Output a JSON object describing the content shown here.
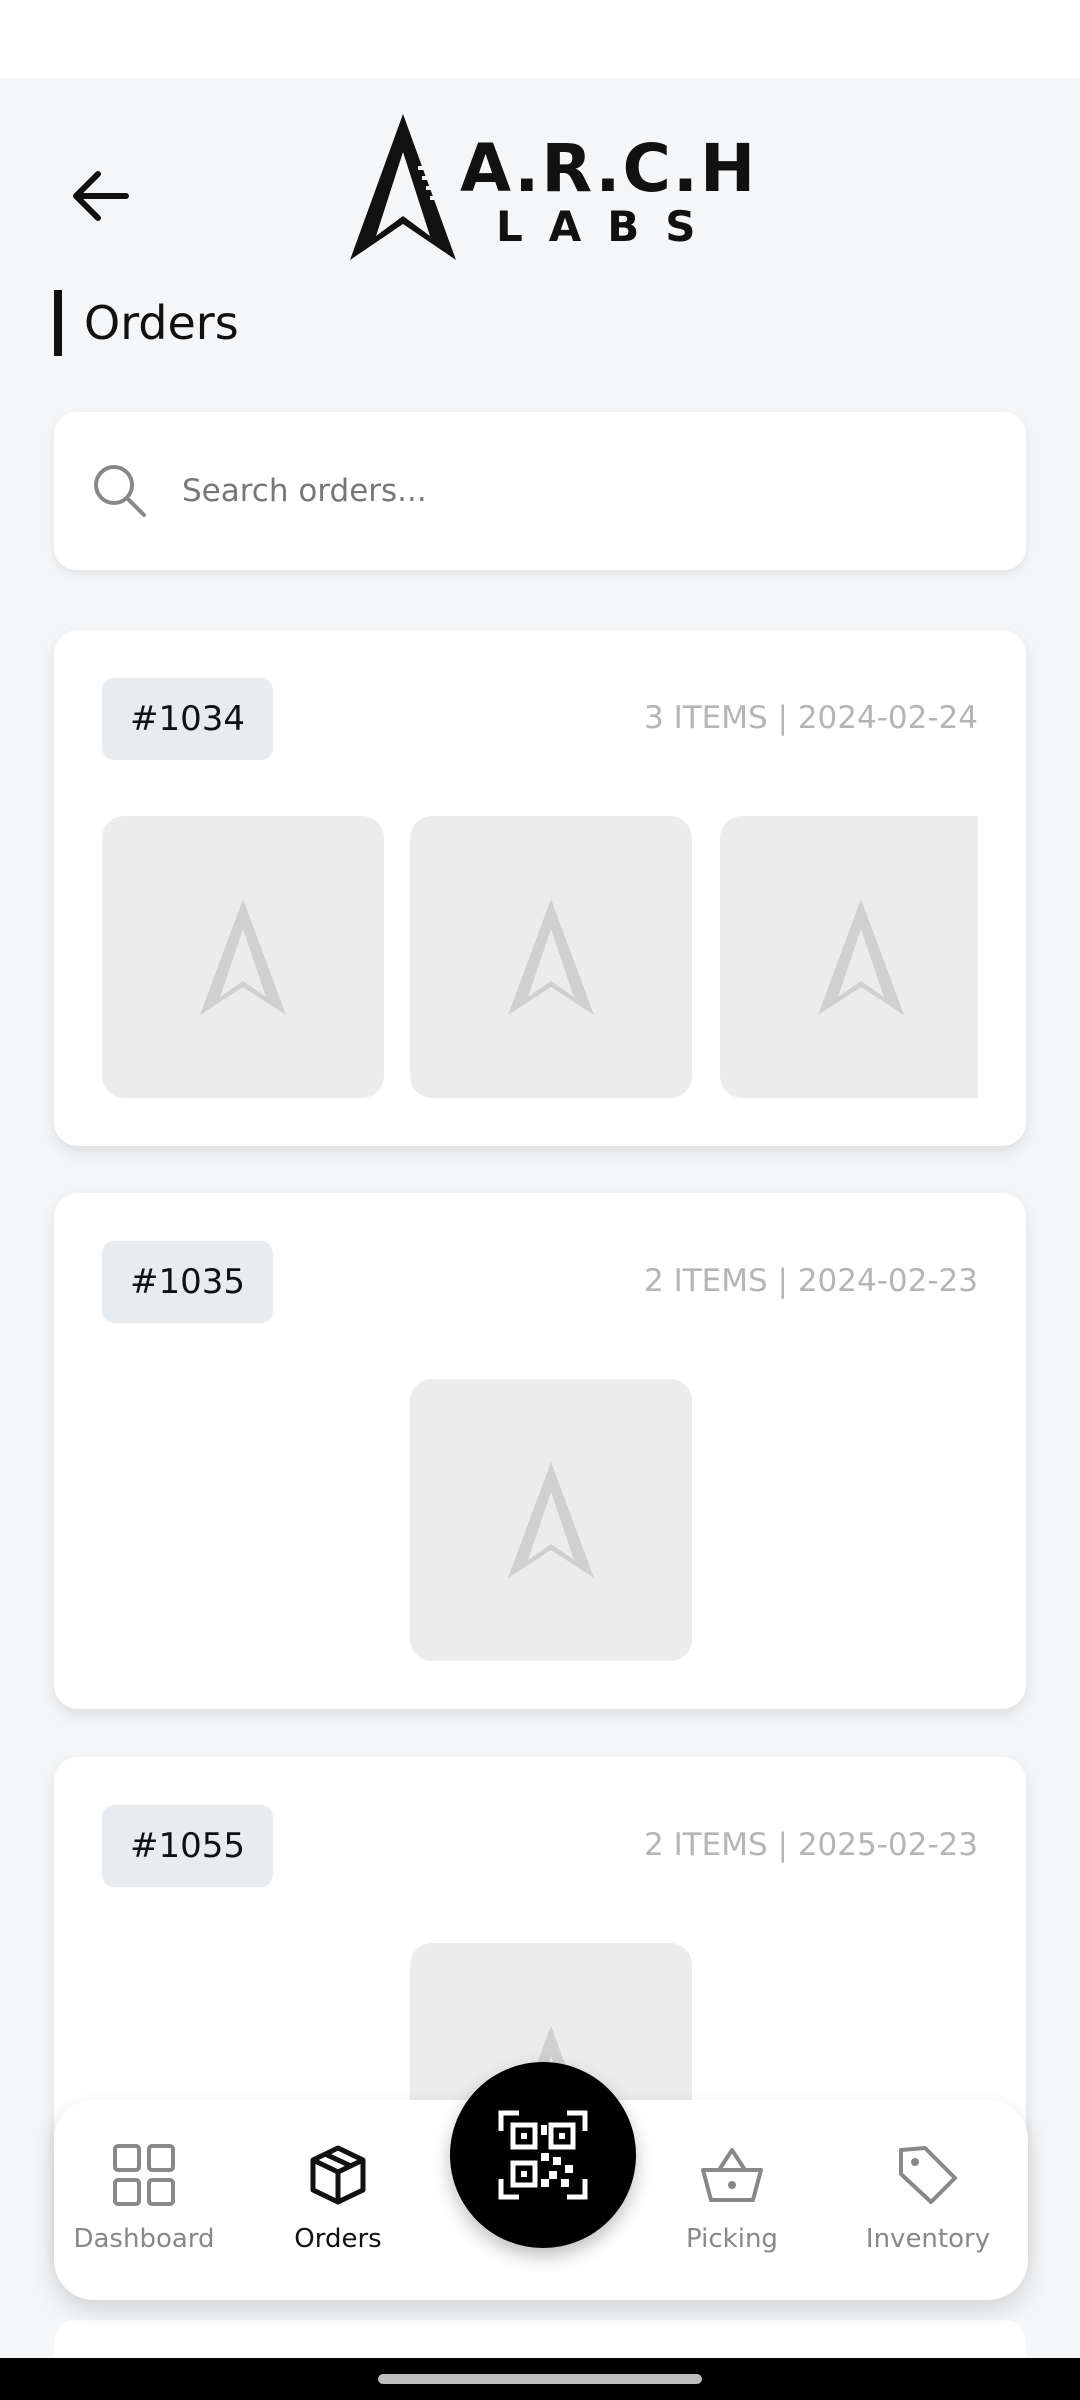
{
  "header": {
    "logo_line1": "A.R.C.H",
    "logo_line2": "LABS"
  },
  "page": {
    "title": "Orders"
  },
  "search": {
    "placeholder": "Search orders..."
  },
  "orders": [
    {
      "id": "#1034",
      "meta": "3 ITEMS | 2024-02-24",
      "thumbs": 3
    },
    {
      "id": "#1035",
      "meta": "2 ITEMS | 2024-02-23",
      "thumbs": 1
    },
    {
      "id": "#1055",
      "meta": "2 ITEMS | 2025-02-23",
      "thumbs": 1
    }
  ],
  "bottom_nav": {
    "items": [
      {
        "label": "Dashboard",
        "icon": "grid-icon",
        "active": false
      },
      {
        "label": "Orders",
        "icon": "box-icon",
        "active": true
      },
      {
        "label": "Picking",
        "icon": "basket-icon",
        "active": false
      },
      {
        "label": "Inventory",
        "icon": "tag-icon",
        "active": false
      }
    ],
    "scan_icon": "qr-code-icon"
  },
  "colors": {
    "background": "#f4f6f8",
    "accent": "#000000",
    "muted_text": "#b5b5b5"
  }
}
